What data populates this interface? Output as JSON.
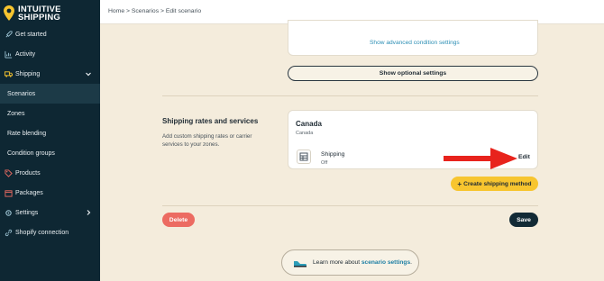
{
  "brand": {
    "line1": "INTUITIVE",
    "line2": "SHIPPING",
    "accent": "#f7c52f"
  },
  "sidebar": {
    "items": [
      {
        "label": "Get started",
        "icon": "rocket-icon"
      },
      {
        "label": "Activity",
        "icon": "chart-icon"
      },
      {
        "label": "Shipping",
        "icon": "truck-icon"
      },
      {
        "label": "Scenarios"
      },
      {
        "label": "Zones"
      },
      {
        "label": "Rate blending"
      },
      {
        "label": "Condition groups"
      },
      {
        "label": "Products",
        "icon": "tag-icon"
      },
      {
        "label": "Packages",
        "icon": "box-icon"
      },
      {
        "label": "Settings",
        "icon": "gear-icon"
      },
      {
        "label": "Shopify connection",
        "icon": "link-icon"
      }
    ]
  },
  "breadcrumb": "Home > Scenarios > Edit scenario",
  "conditions": {
    "advanced_link": "Show advanced condition settings"
  },
  "optional_button": "Show optional settings",
  "rates": {
    "title": "Shipping rates and services",
    "description": "Add custom shipping rates or carrier services to your zones.",
    "zone": {
      "name": "Canada",
      "subtitle": "Canada",
      "method_name": "Shipping",
      "method_status": "Off",
      "edit_label": "Edit"
    },
    "create_button": "Create shipping method"
  },
  "footer": {
    "delete_label": "Delete",
    "save_label": "Save",
    "learn_prefix": "Learn more about ",
    "learn_link": "scenario settings",
    "learn_suffix": "."
  },
  "colors": {
    "arrow": "#e8231c",
    "sidebar": "#0e2733",
    "delete": "#ec6b62"
  }
}
